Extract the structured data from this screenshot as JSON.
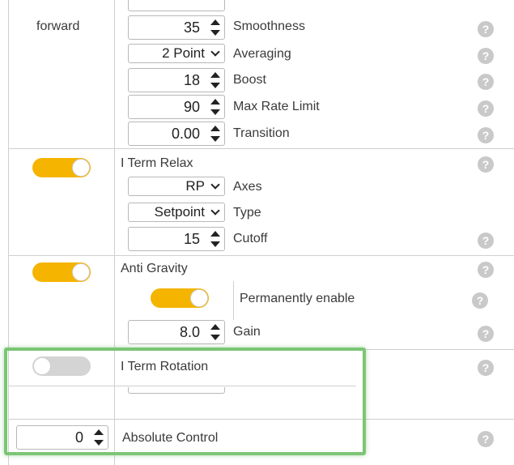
{
  "rows": {
    "forward": {
      "label": "forward",
      "fields": [
        {
          "value": "35",
          "label": "Smoothness"
        },
        {
          "value": "2 Point",
          "label": "Averaging"
        },
        {
          "value": "18",
          "label": "Boost"
        },
        {
          "value": "90",
          "label": "Max Rate Limit"
        },
        {
          "value": "0.00",
          "label": "Transition"
        }
      ]
    },
    "iterm_relax": {
      "title": "I Term Relax",
      "enabled": true,
      "axes": {
        "value": "RP",
        "label": "Axes"
      },
      "type": {
        "value": "Setpoint",
        "label": "Type"
      },
      "cutoff": {
        "value": "15",
        "label": "Cutoff"
      }
    },
    "anti_gravity": {
      "title": "Anti Gravity",
      "enabled": true,
      "permanent": {
        "label": "Permanently enable",
        "enabled": true
      },
      "gain": {
        "value": "8.0",
        "label": "Gain"
      }
    },
    "iterm_rotation": {
      "title": "I Term Rotation",
      "enabled": false
    },
    "absolute_control": {
      "value": "0",
      "label": "Absolute Control"
    }
  },
  "help_glyph": "?",
  "colors": {
    "toggle_on": "#f5b400",
    "toggle_off": "#d4d4d4",
    "highlight": "#7cc576",
    "help": "#c9c9c9"
  }
}
